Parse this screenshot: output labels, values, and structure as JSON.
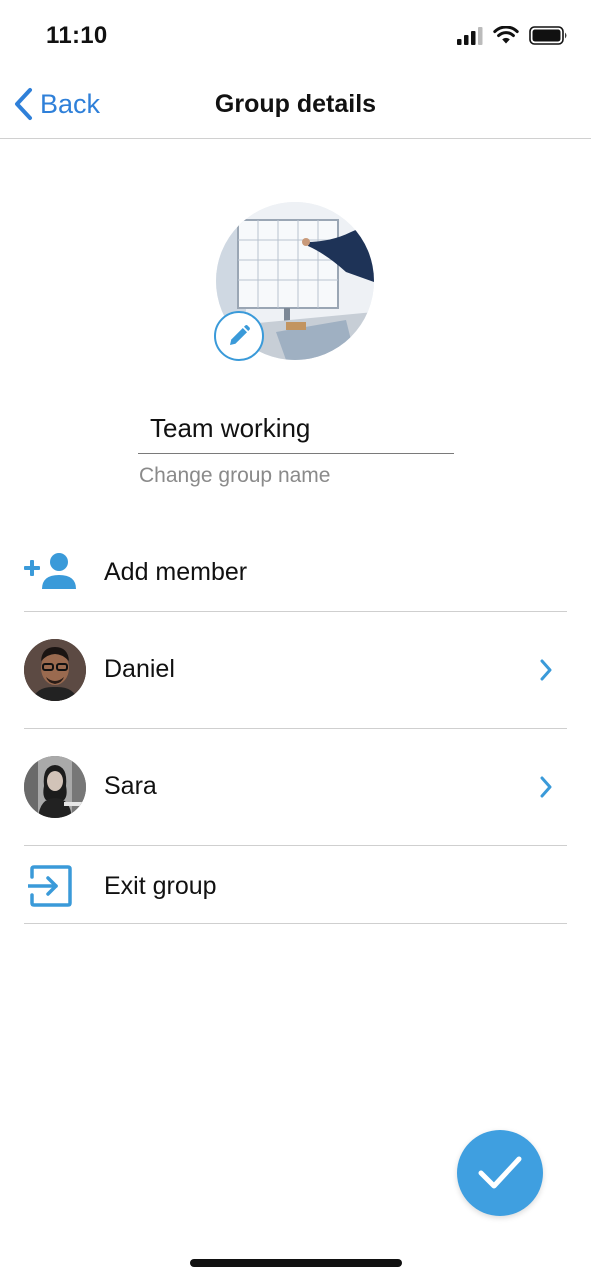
{
  "status_bar": {
    "time": "11:10"
  },
  "nav": {
    "back_label": "Back",
    "title": "Group details"
  },
  "group": {
    "name_value": "Team working",
    "name_helper": "Change group name"
  },
  "list": {
    "add_member_label": "Add member",
    "members": [
      {
        "name": "Daniel"
      },
      {
        "name": "Sara"
      }
    ],
    "exit_label": "Exit group"
  },
  "icons": {
    "back": "chevron-left-icon",
    "edit": "pencil-icon",
    "add_member": "add-person-icon",
    "member_chevron": "chevron-right-icon",
    "exit": "exit-icon",
    "confirm": "checkmark-icon"
  },
  "colors": {
    "accent": "#2f80d9",
    "icon_blue": "#3a9ad9",
    "fab": "#3f9fe0",
    "divider": "#cfcfcf",
    "helper_text": "#8a8a8a"
  }
}
